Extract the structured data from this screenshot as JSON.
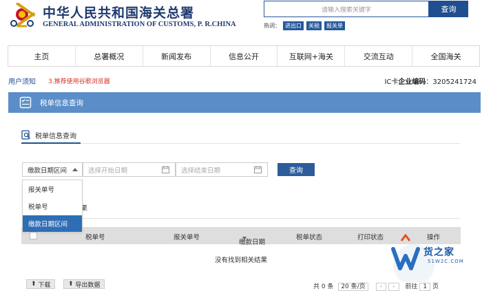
{
  "header": {
    "title_cn": "中华人民共和国海关总署",
    "title_en": "GENERAL ADMINISTRATION OF CUSTOMS, P. R.CHINA",
    "search_placeholder": "请输入搜索关键字",
    "search_button": "查询",
    "hot_label": "热词：",
    "hot_tags": [
      "进出口",
      "关税",
      "报关单"
    ]
  },
  "nav": {
    "items": [
      "主页",
      "总署概况",
      "新闻发布",
      "信息公开",
      "互联网+海关",
      "交流互动",
      "全国海关"
    ]
  },
  "info": {
    "user_notice": "用户须知",
    "warning": "3.推荐使用谷歌浏览器",
    "ic_label": "IC卡",
    "ic_bold": "企业编码",
    "ic_value": "：3205241724"
  },
  "panel": {
    "title": "税单信息查询",
    "tab_label": "税单信息查询"
  },
  "form": {
    "select_value": "缴款日期区间",
    "start_placeholder": "选择开始日期",
    "end_placeholder": "选择结束日期",
    "query_button": "查询",
    "dropdown_options": [
      "报关单号",
      "税单号",
      "缴款日期区间"
    ],
    "dropdown_selected": "缴款日期区间"
  },
  "result": {
    "tab_label_partial": "果",
    "columns": [
      "税单号",
      "报关单号",
      "缴款日期",
      "税单状态",
      "打印状态",
      "操作"
    ],
    "empty_text": "没有找到相关结果"
  },
  "footer": {
    "download_button": "下载",
    "export_button": "导出数据",
    "pager_total": "共 0 条",
    "page_size": "20 条/页",
    "goto_label": "前往",
    "page_number": "1",
    "page_unit": "页"
  },
  "watermark": {
    "brand": "货之家",
    "url": "51W2C.COM"
  },
  "colors": {
    "primary": "#1f4f8e",
    "panel_bar": "#5b8ec8",
    "dropdown_selected": "#2f6db5",
    "warning": "#d7322a"
  }
}
